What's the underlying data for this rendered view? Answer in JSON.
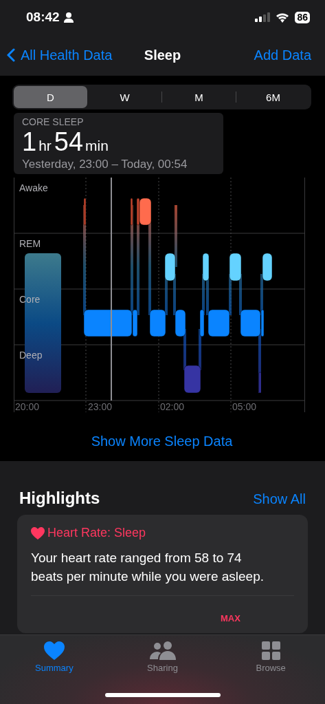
{
  "status_bar": {
    "time": "08:42",
    "battery": "86"
  },
  "nav": {
    "back": "All Health Data",
    "title": "Sleep",
    "action": "Add Data"
  },
  "range_tabs": [
    {
      "label": "D",
      "selected": true
    },
    {
      "label": "W",
      "selected": false
    },
    {
      "label": "M",
      "selected": false
    },
    {
      "label": "6M",
      "selected": false
    }
  ],
  "summary": {
    "category": "CORE SLEEP",
    "hours": "1",
    "hours_unit": "hr",
    "minutes": "54",
    "minutes_unit": "min",
    "period": "Yesterday, 23:00 – Today, 00:54"
  },
  "sleep_chart": {
    "stages": [
      "Awake",
      "REM",
      "Core",
      "Deep"
    ],
    "times": [
      "20:00",
      "23:00",
      "02:00",
      "05:00"
    ]
  },
  "show_more": "Show More Sleep Data",
  "highlights": {
    "title": "Highlights",
    "action": "Show All",
    "card": {
      "title": "Heart Rate: Sleep",
      "text": "Your heart rate ranged from 58 to 74 beats per minute while you were asleep.",
      "stat_label": "MAX"
    }
  },
  "tab_bar": [
    {
      "label": "Summary",
      "kind": "heart",
      "selected": true
    },
    {
      "label": "Sharing",
      "kind": "people",
      "selected": false
    },
    {
      "label": "Browse",
      "kind": "grid",
      "selected": false
    }
  ]
}
